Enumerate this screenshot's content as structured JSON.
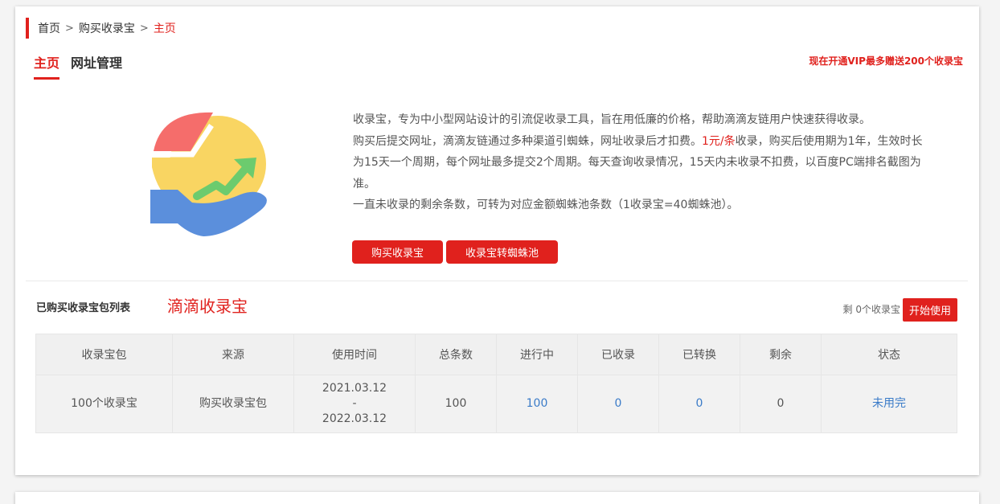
{
  "breadcrumb": {
    "items": [
      "首页",
      "购买收录宝",
      "主页"
    ],
    "separator": ">"
  },
  "tabs": [
    "主页",
    "网址管理"
  ],
  "promo": "现在开通VIP最多赠送200个收录宝",
  "logo": {
    "name": "shoulubao-logo"
  },
  "description": {
    "line1": "收录宝，专为中小型网站设计的引流促收录工具，旨在用低廉的价格，帮助滴滴友链用户快速获得收录。",
    "line2_prefix": "购买后提交网址，滴滴友链通过多种渠道引蜘蛛，网址收录后才扣费。",
    "line2_price": "1元/条",
    "line2_suffix": "收录，购买后使用期为1年，生效时长为15天一个周期，每个网址最多提交2个周期。每天查询收录情况，15天内未收录不扣费，以百度PC端排名截图为准。",
    "line3": "一直未收录的剩余条数，可转为对应金额蜘蛛池条数（1收录宝=40蜘蛛池）。"
  },
  "buttons": {
    "buy": "购买收录宝",
    "convert": "收录宝转蜘蛛池",
    "start": "开始使用"
  },
  "list": {
    "title": "已购买收录宝包列表",
    "brand": "滴滴收录宝",
    "remain": "剩 0个收录宝"
  },
  "table": {
    "headers": [
      "收录宝包",
      "来源",
      "使用时间",
      "总条数",
      "进行中",
      "已收录",
      "已转换",
      "剩余",
      "状态"
    ],
    "rows": [
      {
        "package": "100个收录宝",
        "source": "购买收录宝包",
        "time_start": "2021.03.12",
        "time_sep": "-",
        "time_end": "2022.03.12",
        "total": "100",
        "in_progress": "100",
        "indexed": "0",
        "converted": "0",
        "remaining": "0",
        "status": "未用完"
      }
    ]
  },
  "colors": {
    "accent": "#e0211d",
    "link": "#3a7bc8"
  }
}
